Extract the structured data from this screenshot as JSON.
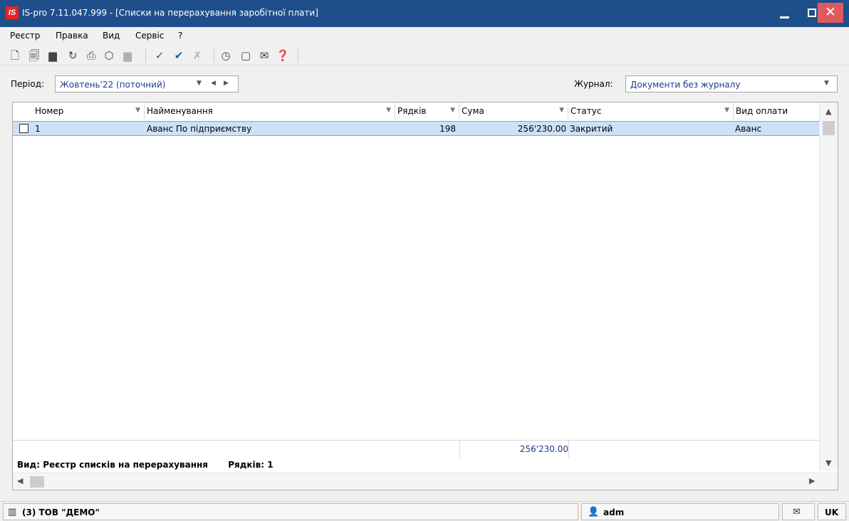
{
  "window": {
    "title": "IS-pro 7.11.047.999 - [Списки на перерахування заробітної плати]",
    "logo_text": "IS"
  },
  "menu": [
    "Реєстр",
    "Правка",
    "Вид",
    "Сервіс",
    "?"
  ],
  "toolbar": {
    "icons": [
      "new-doc-icon",
      "copy-doc-icon",
      "delete-doc-icon",
      "refresh-icon",
      "print-icon",
      "package-icon",
      "disabled-doc-icon",
      "check-icon",
      "double-check-icon",
      "uncheck-icon",
      "calculate-icon",
      "form-icon",
      "email-icon",
      "help-icon"
    ]
  },
  "filters": {
    "period_label": "Період:",
    "period_value": "Жовтень'22 (поточний)",
    "journal_label": "Журнал:",
    "journal_value": "Документи без журналу"
  },
  "grid": {
    "columns": [
      "Номер",
      "Найменування",
      "Рядків",
      "Сума",
      "Статус",
      "Вид оплати"
    ],
    "rows": [
      {
        "number": "1",
        "name": "Аванс По підприємству",
        "rows_count": "198",
        "sum": "256'230.00",
        "status": "Закритий",
        "payment_type": "Аванс"
      }
    ],
    "total_sum": "256'230.00",
    "footer_view": "Вид: Реєстр списків на перерахування",
    "footer_rows": "Рядків: 1"
  },
  "statusbar": {
    "org": "(3) ТОВ \"ДЕМО\"",
    "user": "adm",
    "lang": "UK"
  }
}
